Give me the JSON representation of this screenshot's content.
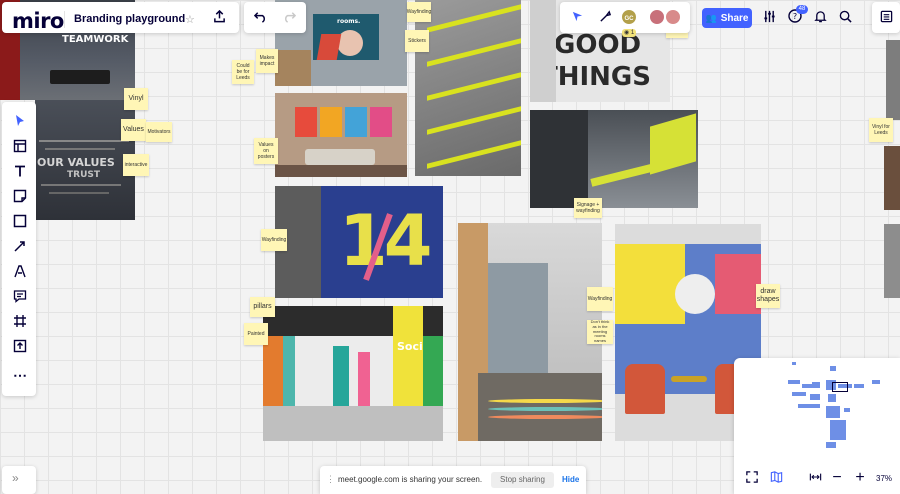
{
  "app": {
    "logo": "miro",
    "board_title": "Branding playground"
  },
  "toolbar": {
    "upload_icon": "upload-icon",
    "undo_icon": "undo-icon",
    "redo_icon": "redo-icon"
  },
  "collab": {
    "avatars": [
      {
        "initials": "GC",
        "color": "#b3a04a"
      },
      {
        "initials": "",
        "color": "#c8707a"
      },
      {
        "initials": "",
        "color": "#d88a8a"
      }
    ],
    "viewer_count": "1",
    "share_label": "Share",
    "notification_count": "48"
  },
  "left_tools": [
    "select-tool",
    "templates-tool",
    "text-tool",
    "sticky-note-tool",
    "shape-tool",
    "connection-line-tool",
    "pen-tool",
    "comment-tool",
    "frame-tool",
    "upload-tool",
    "more-tools"
  ],
  "stickies": {
    "vinyl": "Vinyl",
    "values": "Values",
    "motivators": "Motivators",
    "interactive": "interactive",
    "could_be_leeds": "Could be for Leeds",
    "makes_impact": "Makes impact",
    "wayfinding_top": "Wayfinding",
    "stickers": "Stickers",
    "values_posters": "Values on posters",
    "wayfinding_mid": "Wayfinding",
    "pillars": "pillars",
    "painted": "Painted",
    "signage": "Signage + wayfinding",
    "wayfinding_right": "Wayfinding",
    "dont_think": "Don't think as in the meeting rooms names",
    "draw_shapes": "draw shapes",
    "vinyl_leeds": "Vinyl for Leeds"
  },
  "photo_text": {
    "teamwork": "TEAMWORK",
    "our_values": "OUR VALUES",
    "trust": "TRUST",
    "good": "GOOD",
    "things": "THINGS",
    "rooms": "rooms.",
    "numbers": "14",
    "social": "Social"
  },
  "minimap": {
    "zoom": "37%"
  },
  "screen_share": {
    "message": "meet.google.com is sharing your screen.",
    "stop_label": "Stop sharing",
    "hide_label": "Hide"
  },
  "colors": {
    "accent": "#4262ff",
    "sticky": "#fff6b6",
    "brand": "#050038"
  }
}
